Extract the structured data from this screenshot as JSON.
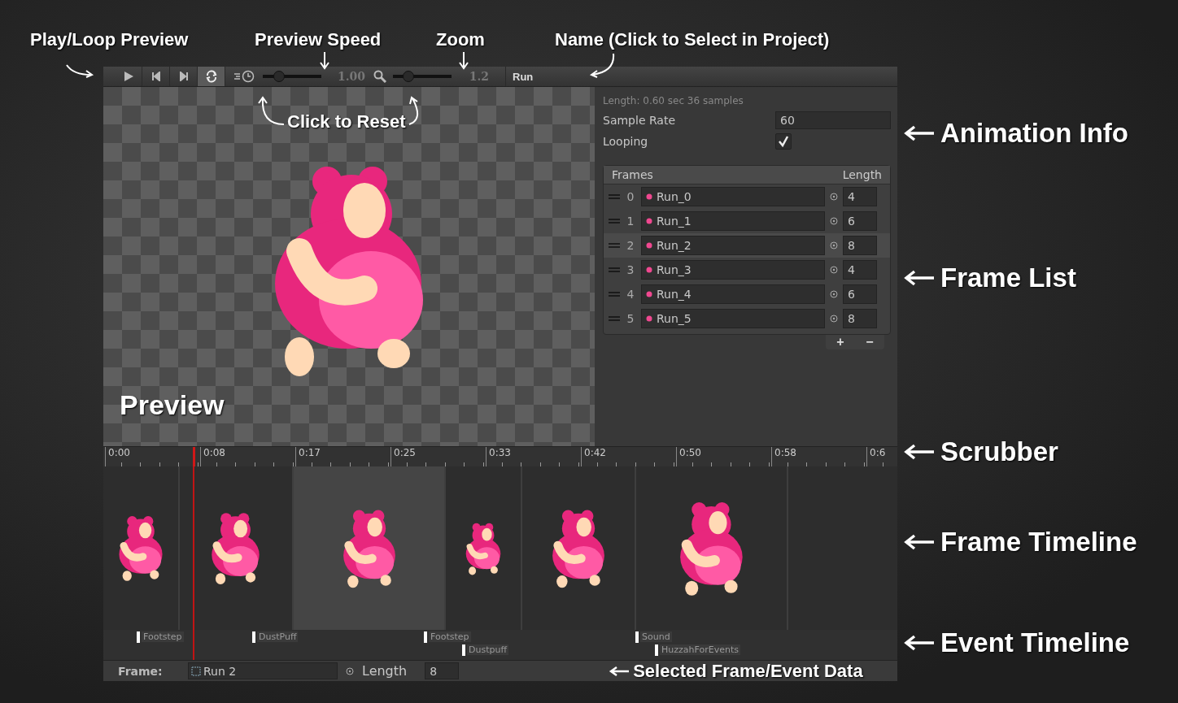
{
  "top_callouts": [
    "Play/Loop Preview",
    "Preview Speed",
    "Zoom",
    "Name (Click to Select in Project)"
  ],
  "side_callouts": [
    "Animation Info",
    "Frame List",
    "Scrubber",
    "Frame Timeline",
    "Event Timeline"
  ],
  "toolbar": {
    "loop_preview": true,
    "speed": {
      "level": 0.28,
      "value": "1.00"
    },
    "zoom": {
      "level": 0.27,
      "value": "1.2"
    },
    "name": "Run"
  },
  "preview": {
    "reset_callout": "Click to Reset",
    "label": "Preview"
  },
  "info": {
    "length_text": "Length: 0.60 sec  36 samples",
    "sample_rate_label": "Sample Rate",
    "sample_rate": "60",
    "looping_label": "Looping",
    "looping": true
  },
  "frames": {
    "header": "Frames",
    "length_header": "Length",
    "add": "+",
    "remove": "−",
    "rows": [
      {
        "index": "0",
        "name": "Run_0",
        "length": "4",
        "selected": false
      },
      {
        "index": "1",
        "name": "Run_1",
        "length": "6",
        "selected": false
      },
      {
        "index": "2",
        "name": "Run_2",
        "length": "8",
        "selected": true
      },
      {
        "index": "3",
        "name": "Run_3",
        "length": "4",
        "selected": false
      },
      {
        "index": "4",
        "name": "Run_4",
        "length": "6",
        "selected": false
      },
      {
        "index": "5",
        "name": "Run_5",
        "length": "8",
        "selected": false
      }
    ]
  },
  "scrubber": {
    "level": 0.113,
    "ticks": [
      "0:00",
      "0:08",
      "0:17",
      "0:25",
      "0:33",
      "0:42",
      "0:50",
      "0:58",
      "0:6"
    ]
  },
  "events": [
    {
      "label": "Footstep",
      "kind": "top"
    },
    {
      "label": "DustPuff",
      "kind": "top"
    },
    {
      "label": "Footstep",
      "kind": "top"
    },
    {
      "label": "Dustpuff",
      "kind": "bottom"
    },
    {
      "label": "Sound",
      "kind": "top"
    },
    {
      "label": "HuzzahForEvents",
      "kind": "bottom"
    }
  ],
  "footer": {
    "label": "Frame:",
    "frame": "Run 2",
    "length_label": "Length",
    "length": "8",
    "callout": "Selected Frame/Event Data"
  }
}
